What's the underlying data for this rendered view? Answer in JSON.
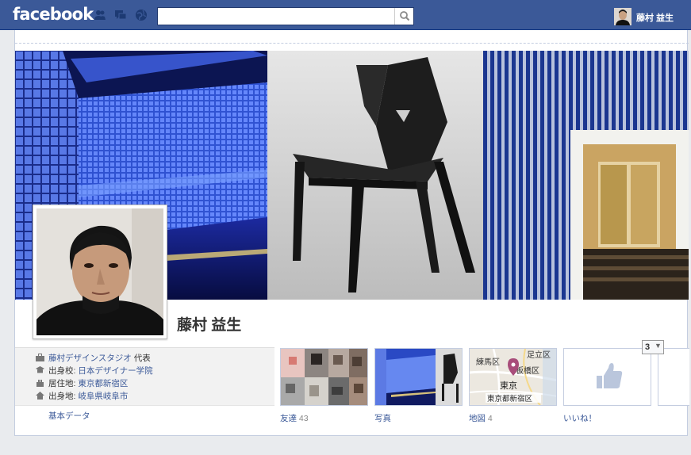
{
  "brand": {
    "logo_text": "facebook",
    "bar_color": "#3b5998"
  },
  "topbar": {
    "icons": [
      "friend-requests-icon",
      "messages-icon",
      "notifications-icon"
    ],
    "search": {
      "value": "",
      "placeholder": ""
    },
    "user": {
      "name": "藤村 益生"
    }
  },
  "profile": {
    "name": "藤村 益生"
  },
  "info": {
    "items": [
      {
        "icon": "briefcase-icon",
        "link": "藤村デザインスタジオ",
        "suffix": " 代表",
        "prefix": ""
      },
      {
        "icon": "graduation-cap-icon",
        "prefix": "出身校: ",
        "link": "日本デザイナー学院",
        "suffix": ""
      },
      {
        "icon": "house-icon",
        "prefix": "居住地: ",
        "link": "東京都新宿区",
        "suffix": ""
      },
      {
        "icon": "hometown-icon",
        "prefix": "出身地: ",
        "link": "岐阜県岐阜市",
        "suffix": ""
      }
    ],
    "basic_data_link": "基本データ"
  },
  "apps": [
    {
      "label": "友達",
      "count": "43"
    },
    {
      "label": "写真",
      "count": ""
    },
    {
      "label": "地図",
      "count": "4"
    },
    {
      "label": "いいね！",
      "count": ""
    }
  ],
  "map_labels": {
    "nerima": "練馬区",
    "adachi": "足立区",
    "itabashi": "板橋区",
    "tokyo": "東京",
    "shinjuku": "東京都新宿区"
  },
  "more_button": {
    "count": "3",
    "arrow": "▼"
  }
}
